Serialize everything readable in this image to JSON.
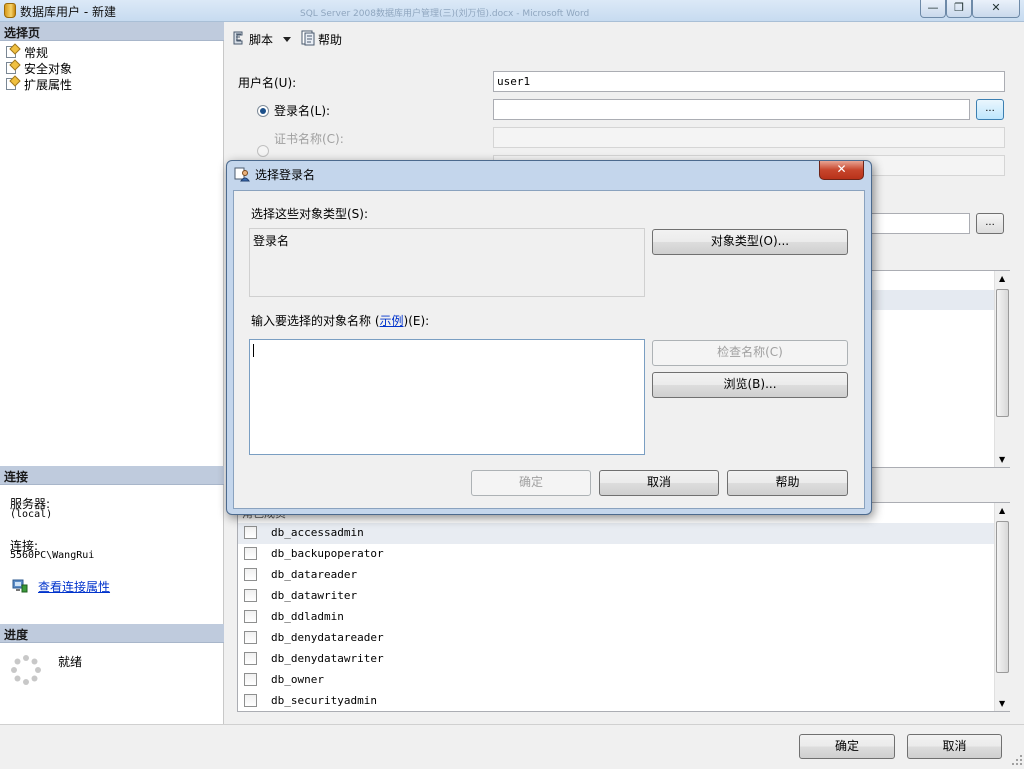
{
  "window": {
    "title": "数据库用户 - 新建",
    "background_title_ghost": "SQL Server 2008数据库用户管理(三)(刘万恒).docx - Microsoft Word",
    "minimize": "—",
    "maximize": "❐",
    "close": "✕"
  },
  "sidebar": {
    "select_page_header": "选择页",
    "pages": [
      {
        "label": "常规"
      },
      {
        "label": "安全对象"
      },
      {
        "label": "扩展属性"
      }
    ],
    "connection_header": "连接",
    "server_label": "服务器:",
    "server_value": "(local)",
    "connection_label": "连接:",
    "connection_value": "5560PC\\WangRui",
    "view_connection_link": "查看连接属性",
    "progress_header": "进度",
    "progress_status": "就绪"
  },
  "toolbar": {
    "script_label": "脚本",
    "help_label": "帮助"
  },
  "form": {
    "username_label": "用户名(U):",
    "username_value": "user1",
    "login_label": "登录名(L):",
    "login_value": "",
    "cert_label": "证书名称(C):",
    "browse_button": "..."
  },
  "roles": {
    "header": "角色成员",
    "items": [
      {
        "name": "db_accessadmin",
        "checked": false
      },
      {
        "name": "db_backupoperator",
        "checked": false
      },
      {
        "name": "db_datareader",
        "checked": false
      },
      {
        "name": "db_datawriter",
        "checked": false
      },
      {
        "name": "db_ddladmin",
        "checked": false
      },
      {
        "name": "db_denydatareader",
        "checked": false
      },
      {
        "name": "db_denydatawriter",
        "checked": false
      },
      {
        "name": "db_owner",
        "checked": false
      },
      {
        "name": "db_securityadmin",
        "checked": false
      }
    ]
  },
  "footer": {
    "ok_label": "确定",
    "cancel_label": "取消"
  },
  "dialog": {
    "title": "选择登录名",
    "close": "✕",
    "object_types_label": "选择这些对象类型(S):",
    "object_types_value": "登录名",
    "object_types_button": "对象类型(O)...",
    "enter_names_label_pre": "输入要选择的对象名称 (",
    "enter_names_link": "示例",
    "enter_names_label_post": ")(E):",
    "names_value": "",
    "check_names_button": "检查名称(C)",
    "browse_button": "浏览(B)...",
    "ok_label": "确定",
    "cancel_label": "取消",
    "help_label": "帮助"
  },
  "colors": {
    "section_header_bg": "#bfcbdd",
    "link": "#0033cc",
    "dialog_frame": "#c4d6ec",
    "close_red": "#c7452c"
  }
}
